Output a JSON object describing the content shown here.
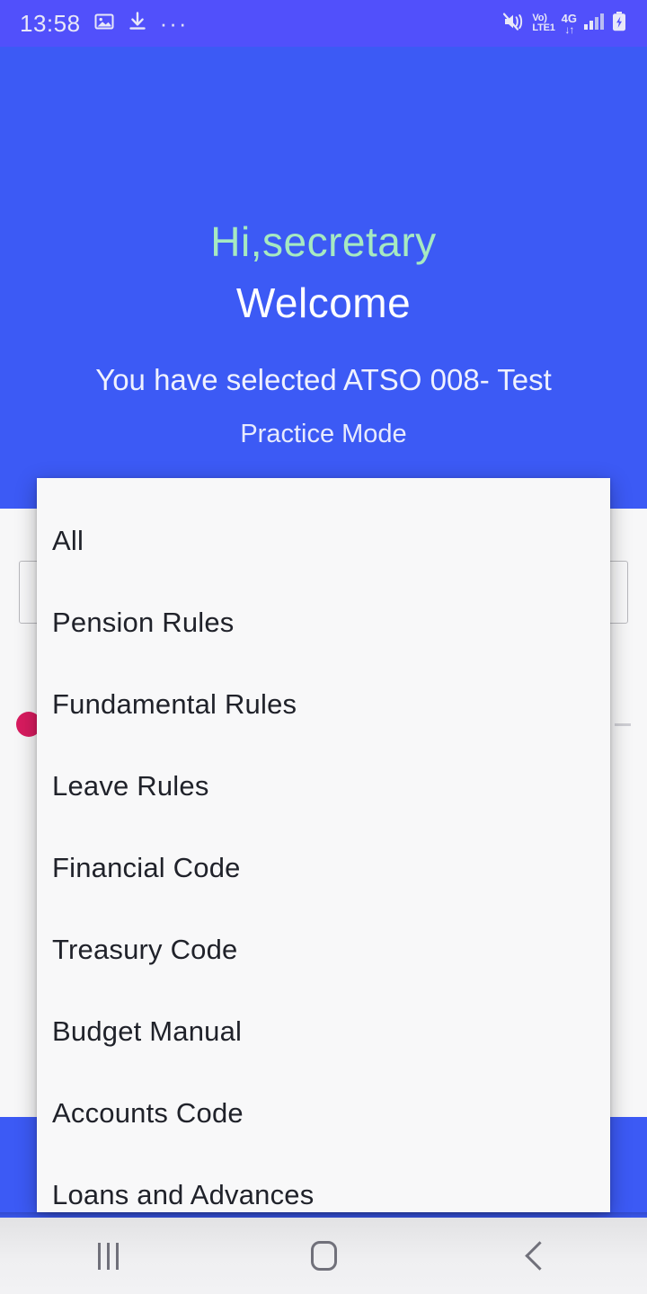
{
  "status_bar": {
    "time": "13:58",
    "left_icons": [
      "image-icon",
      "download-icon",
      "more-dots-icon"
    ],
    "overflow_dots": "···",
    "right_icons": [
      "mute-icon",
      "volte-icon",
      "network-4g-icon",
      "signal-bars-icon",
      "battery-charging-icon"
    ],
    "volte_top": "Vo)",
    "volte_bottom": "LTE1",
    "network_type": "4G",
    "network_arrows": "↓↑",
    "background_color": "#5150FB",
    "text_color": "#E8E8F8"
  },
  "hero": {
    "greeting": "Hi,secretary",
    "welcome": "Welcome",
    "selected_line": "You have selected ATSO 008- Test",
    "mode_line": "Practice Mode",
    "background_color": "#3C5AF5",
    "greeting_color": "#A6E9C1",
    "welcome_color": "#FFFFFF"
  },
  "page_body": {
    "select_box_value": "",
    "loader_dot_color": "#D81B5F",
    "background_color": "#F7F7F8"
  },
  "dropdown": {
    "background_color": "#F8F8F9",
    "items": [
      {
        "label": "All"
      },
      {
        "label": "Pension Rules"
      },
      {
        "label": "Fundamental Rules"
      },
      {
        "label": "Leave Rules"
      },
      {
        "label": "Financial Code"
      },
      {
        "label": "Treasury Code"
      },
      {
        "label": "Budget Manual"
      },
      {
        "label": "Accounts Code"
      },
      {
        "label": "Loans and Advances"
      }
    ]
  },
  "nav_bar": {
    "recents_label": "Recents",
    "home_label": "Home",
    "back_label": "Back",
    "icon_color": "#70707A"
  }
}
